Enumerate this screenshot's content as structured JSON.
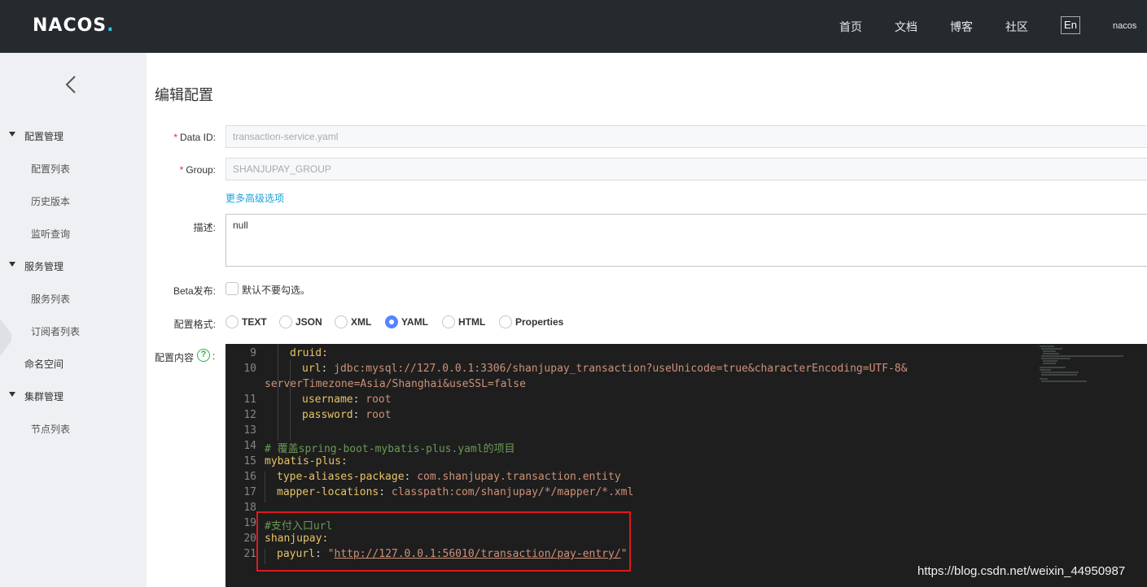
{
  "header": {
    "logo_main": "NACOS",
    "logo_dot": ".",
    "nav": [
      "首页",
      "文档",
      "博客",
      "社区"
    ],
    "lang": "En",
    "user": "nacos"
  },
  "sidebar": {
    "groups": [
      {
        "label": "配置管理",
        "items": [
          "配置列表",
          "历史版本",
          "监听查询"
        ]
      },
      {
        "label": "服务管理",
        "items": [
          "服务列表",
          "订阅者列表"
        ]
      },
      {
        "label": "命名空间",
        "items": []
      },
      {
        "label": "集群管理",
        "items": [
          "节点列表"
        ]
      }
    ]
  },
  "form": {
    "title": "编辑配置",
    "data_id_label": "Data ID:",
    "data_id_value": "transaction-service.yaml",
    "group_label": "Group:",
    "group_value": "SHANJUPAY_GROUP",
    "advanced_link": "更多高级选项",
    "desc_label": "描述:",
    "desc_value": "null",
    "beta_label": "Beta发布:",
    "beta_checkbox_label": "默认不要勾选。",
    "format_label": "配置格式:",
    "formats": [
      "TEXT",
      "JSON",
      "XML",
      "YAML",
      "HTML",
      "Properties"
    ],
    "selected_format": "YAML",
    "content_label": "配置内容",
    "content_colon": ":",
    "help_icon_text": "?"
  },
  "editor": {
    "lines": [
      {
        "n": "9",
        "text": "druid:"
      },
      {
        "n": "10",
        "text": "url: jdbc:mysql://127.0.0.1:3306/shanjupay_transaction?useUnicode=true&characterEncoding=UTF-8&"
      },
      {
        "n": "",
        "text": "serverTimezone=Asia/Shanghai&useSSL=false"
      },
      {
        "n": "11",
        "text": "username: root"
      },
      {
        "n": "12",
        "text": "password: root"
      },
      {
        "n": "13",
        "text": ""
      },
      {
        "n": "14",
        "text": "# 覆盖spring-boot-mybatis-plus.yaml的项目"
      },
      {
        "n": "15",
        "text": "mybatis-plus:"
      },
      {
        "n": "16",
        "text": "type-aliases-package: com.shanjupay.transaction.entity"
      },
      {
        "n": "17",
        "text": "mapper-locations: classpath:com/shanjupay/*/mapper/*.xml"
      },
      {
        "n": "18",
        "text": ""
      },
      {
        "n": "19",
        "text": "#支付入口url"
      },
      {
        "n": "20",
        "text": "shanjupay:"
      },
      {
        "n": "21",
        "text": "payurl: \"http://127.0.0.1:56010/transaction/pay-entry/\""
      }
    ]
  },
  "watermark": "https://blog.csdn.net/weixin_44950987",
  "colors": {
    "topbar": "#252a2f",
    "sidebar": "#eef0f3",
    "editor_bg": "#1e1e1e",
    "accent": "#5584ff",
    "highlight_box": "#e0171f"
  }
}
